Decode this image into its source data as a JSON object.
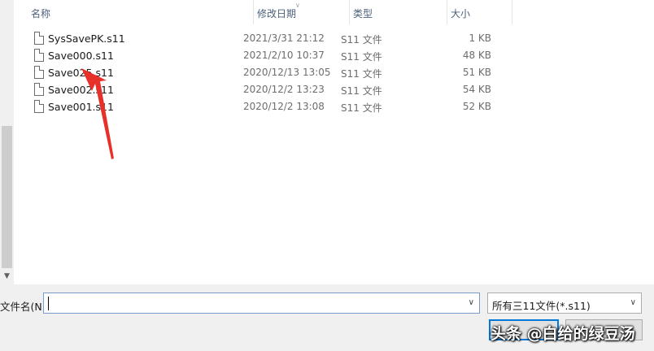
{
  "columns": {
    "name": "名称",
    "date": "修改日期",
    "type": "类型",
    "size": "大小"
  },
  "files": [
    {
      "name": "SysSavePK.s11",
      "date": "2021/3/31 21:12",
      "type": "S11 文件",
      "size": "1 KB"
    },
    {
      "name": "Save000.s11",
      "date": "2021/2/10 10:37",
      "type": "S11 文件",
      "size": "48 KB"
    },
    {
      "name": "Save025.s11",
      "date": "2020/12/13 13:05",
      "type": "S11 文件",
      "size": "51 KB"
    },
    {
      "name": "Save002.s11",
      "date": "2020/12/2 13:23",
      "type": "S11 文件",
      "size": "54 KB"
    },
    {
      "name": "Save001.s11",
      "date": "2020/12/2 13:08",
      "type": "S11 文件",
      "size": "52 KB"
    }
  ],
  "bottom": {
    "filename_label": "文件名(N):",
    "filename_value": "",
    "file_type_selected": "所有三11文件(*.s11)"
  },
  "watermark": "头条 @白给的绿豆汤",
  "colors": {
    "annotation_arrow": "#e8302a",
    "focus_border": "#0078d7"
  },
  "icons": {
    "file": "file-icon",
    "sort": "chevron-up-icon",
    "dropdown": "chevron-down-icon"
  }
}
